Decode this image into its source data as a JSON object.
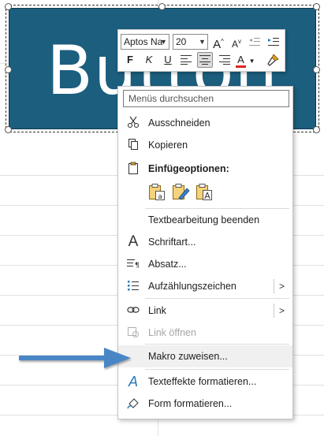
{
  "shape": {
    "text": "Button",
    "fill": "#1c5e7e"
  },
  "mini_toolbar": {
    "font_name": "Aptos Na",
    "font_size": "20",
    "grow_font_label": "A",
    "shrink_font_label": "A",
    "bold_label": "F",
    "italic_label": "K",
    "underline_label": "U",
    "font_color_label": "A",
    "font_color": "#e02424"
  },
  "context_menu": {
    "search_placeholder": "Menüs durchsuchen",
    "items": [
      {
        "label": "Ausschneiden",
        "icon": "scissors-icon",
        "enabled": true
      },
      {
        "label": "Kopieren",
        "icon": "copy-icon",
        "enabled": true
      },
      {
        "label": "Einfügeoptionen:",
        "icon": "clipboard-icon",
        "enabled": true
      },
      {
        "label": "Textbearbeitung beenden",
        "icon": "",
        "enabled": true
      },
      {
        "label": "Schriftart...",
        "icon": "font-icon",
        "enabled": true
      },
      {
        "label": "Absatz...",
        "icon": "paragraph-icon",
        "enabled": true
      },
      {
        "label": "Aufzählungszeichen",
        "icon": "bullets-icon",
        "enabled": true
      },
      {
        "label": "Link",
        "icon": "link-icon",
        "enabled": true
      },
      {
        "label": "Link öffnen",
        "icon": "open-link-icon",
        "enabled": false
      },
      {
        "label": "Makro zuweisen...",
        "icon": "",
        "enabled": true
      },
      {
        "label": "Texteffekte formatieren...",
        "icon": "text-effects-icon",
        "enabled": true
      },
      {
        "label": "Form formatieren...",
        "icon": "format-shape-icon",
        "enabled": true
      }
    ],
    "paste_letters": [
      "a",
      "",
      "A"
    ]
  },
  "colors": {
    "accent_arrow": "#4a86c6",
    "menu_border": "#c6c6c6"
  }
}
